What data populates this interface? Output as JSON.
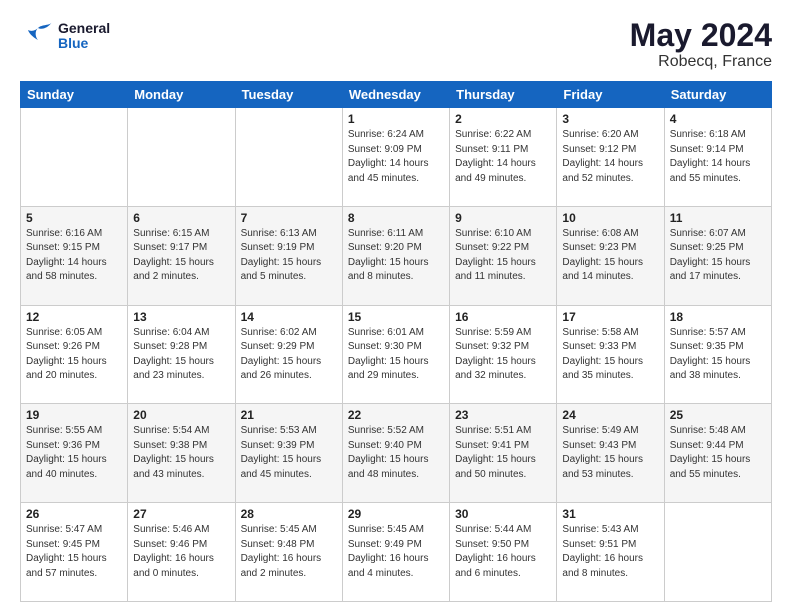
{
  "header": {
    "logo_line1": "General",
    "logo_line2": "Blue",
    "month": "May 2024",
    "location": "Robecq, France"
  },
  "weekdays": [
    "Sunday",
    "Monday",
    "Tuesday",
    "Wednesday",
    "Thursday",
    "Friday",
    "Saturday"
  ],
  "weeks": [
    [
      {
        "day": "",
        "sunrise": "",
        "sunset": "",
        "daylight": ""
      },
      {
        "day": "",
        "sunrise": "",
        "sunset": "",
        "daylight": ""
      },
      {
        "day": "",
        "sunrise": "",
        "sunset": "",
        "daylight": ""
      },
      {
        "day": "1",
        "sunrise": "Sunrise: 6:24 AM",
        "sunset": "Sunset: 9:09 PM",
        "daylight": "Daylight: 14 hours and 45 minutes."
      },
      {
        "day": "2",
        "sunrise": "Sunrise: 6:22 AM",
        "sunset": "Sunset: 9:11 PM",
        "daylight": "Daylight: 14 hours and 49 minutes."
      },
      {
        "day": "3",
        "sunrise": "Sunrise: 6:20 AM",
        "sunset": "Sunset: 9:12 PM",
        "daylight": "Daylight: 14 hours and 52 minutes."
      },
      {
        "day": "4",
        "sunrise": "Sunrise: 6:18 AM",
        "sunset": "Sunset: 9:14 PM",
        "daylight": "Daylight: 14 hours and 55 minutes."
      }
    ],
    [
      {
        "day": "5",
        "sunrise": "Sunrise: 6:16 AM",
        "sunset": "Sunset: 9:15 PM",
        "daylight": "Daylight: 14 hours and 58 minutes."
      },
      {
        "day": "6",
        "sunrise": "Sunrise: 6:15 AM",
        "sunset": "Sunset: 9:17 PM",
        "daylight": "Daylight: 15 hours and 2 minutes."
      },
      {
        "day": "7",
        "sunrise": "Sunrise: 6:13 AM",
        "sunset": "Sunset: 9:19 PM",
        "daylight": "Daylight: 15 hours and 5 minutes."
      },
      {
        "day": "8",
        "sunrise": "Sunrise: 6:11 AM",
        "sunset": "Sunset: 9:20 PM",
        "daylight": "Daylight: 15 hours and 8 minutes."
      },
      {
        "day": "9",
        "sunrise": "Sunrise: 6:10 AM",
        "sunset": "Sunset: 9:22 PM",
        "daylight": "Daylight: 15 hours and 11 minutes."
      },
      {
        "day": "10",
        "sunrise": "Sunrise: 6:08 AM",
        "sunset": "Sunset: 9:23 PM",
        "daylight": "Daylight: 15 hours and 14 minutes."
      },
      {
        "day": "11",
        "sunrise": "Sunrise: 6:07 AM",
        "sunset": "Sunset: 9:25 PM",
        "daylight": "Daylight: 15 hours and 17 minutes."
      }
    ],
    [
      {
        "day": "12",
        "sunrise": "Sunrise: 6:05 AM",
        "sunset": "Sunset: 9:26 PM",
        "daylight": "Daylight: 15 hours and 20 minutes."
      },
      {
        "day": "13",
        "sunrise": "Sunrise: 6:04 AM",
        "sunset": "Sunset: 9:28 PM",
        "daylight": "Daylight: 15 hours and 23 minutes."
      },
      {
        "day": "14",
        "sunrise": "Sunrise: 6:02 AM",
        "sunset": "Sunset: 9:29 PM",
        "daylight": "Daylight: 15 hours and 26 minutes."
      },
      {
        "day": "15",
        "sunrise": "Sunrise: 6:01 AM",
        "sunset": "Sunset: 9:30 PM",
        "daylight": "Daylight: 15 hours and 29 minutes."
      },
      {
        "day": "16",
        "sunrise": "Sunrise: 5:59 AM",
        "sunset": "Sunset: 9:32 PM",
        "daylight": "Daylight: 15 hours and 32 minutes."
      },
      {
        "day": "17",
        "sunrise": "Sunrise: 5:58 AM",
        "sunset": "Sunset: 9:33 PM",
        "daylight": "Daylight: 15 hours and 35 minutes."
      },
      {
        "day": "18",
        "sunrise": "Sunrise: 5:57 AM",
        "sunset": "Sunset: 9:35 PM",
        "daylight": "Daylight: 15 hours and 38 minutes."
      }
    ],
    [
      {
        "day": "19",
        "sunrise": "Sunrise: 5:55 AM",
        "sunset": "Sunset: 9:36 PM",
        "daylight": "Daylight: 15 hours and 40 minutes."
      },
      {
        "day": "20",
        "sunrise": "Sunrise: 5:54 AM",
        "sunset": "Sunset: 9:38 PM",
        "daylight": "Daylight: 15 hours and 43 minutes."
      },
      {
        "day": "21",
        "sunrise": "Sunrise: 5:53 AM",
        "sunset": "Sunset: 9:39 PM",
        "daylight": "Daylight: 15 hours and 45 minutes."
      },
      {
        "day": "22",
        "sunrise": "Sunrise: 5:52 AM",
        "sunset": "Sunset: 9:40 PM",
        "daylight": "Daylight: 15 hours and 48 minutes."
      },
      {
        "day": "23",
        "sunrise": "Sunrise: 5:51 AM",
        "sunset": "Sunset: 9:41 PM",
        "daylight": "Daylight: 15 hours and 50 minutes."
      },
      {
        "day": "24",
        "sunrise": "Sunrise: 5:49 AM",
        "sunset": "Sunset: 9:43 PM",
        "daylight": "Daylight: 15 hours and 53 minutes."
      },
      {
        "day": "25",
        "sunrise": "Sunrise: 5:48 AM",
        "sunset": "Sunset: 9:44 PM",
        "daylight": "Daylight: 15 hours and 55 minutes."
      }
    ],
    [
      {
        "day": "26",
        "sunrise": "Sunrise: 5:47 AM",
        "sunset": "Sunset: 9:45 PM",
        "daylight": "Daylight: 15 hours and 57 minutes."
      },
      {
        "day": "27",
        "sunrise": "Sunrise: 5:46 AM",
        "sunset": "Sunset: 9:46 PM",
        "daylight": "Daylight: 16 hours and 0 minutes."
      },
      {
        "day": "28",
        "sunrise": "Sunrise: 5:45 AM",
        "sunset": "Sunset: 9:48 PM",
        "daylight": "Daylight: 16 hours and 2 minutes."
      },
      {
        "day": "29",
        "sunrise": "Sunrise: 5:45 AM",
        "sunset": "Sunset: 9:49 PM",
        "daylight": "Daylight: 16 hours and 4 minutes."
      },
      {
        "day": "30",
        "sunrise": "Sunrise: 5:44 AM",
        "sunset": "Sunset: 9:50 PM",
        "daylight": "Daylight: 16 hours and 6 minutes."
      },
      {
        "day": "31",
        "sunrise": "Sunrise: 5:43 AM",
        "sunset": "Sunset: 9:51 PM",
        "daylight": "Daylight: 16 hours and 8 minutes."
      },
      {
        "day": "",
        "sunrise": "",
        "sunset": "",
        "daylight": ""
      }
    ]
  ]
}
